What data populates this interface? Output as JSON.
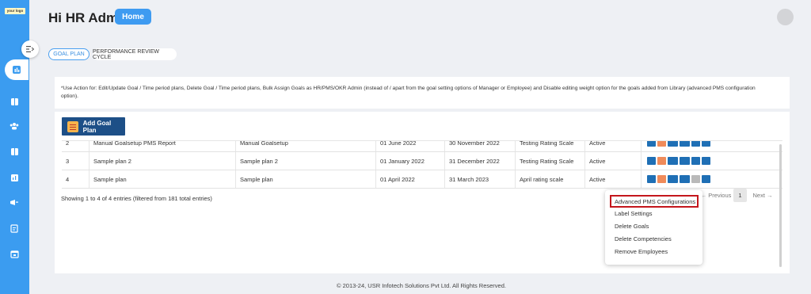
{
  "sidebar": {
    "logo_text": "your logo",
    "accent": "#3b9cf0"
  },
  "header": {
    "title": "Hi HR Admin",
    "home_label": "Home"
  },
  "tabs": [
    {
      "label": "GOAL PLAN",
      "active": true
    },
    {
      "label": "PERFORMANCE REVIEW CYCLE",
      "active": false
    }
  ],
  "info_note": "*Use Action for: Edit/Update Goal / Time period plans, Delete Goal / Time period plans, Bulk Assign Goals as HR/PMS/OKR Admin (instead of / apart from the goal setting options of Manager or Employee) and Disable editing weight option for the goals added from Library (advanced PMS configuration option).",
  "add_button_label": "Add Goal Plan",
  "table": {
    "rows": [
      {
        "no": "2",
        "plan": "Manual Goalsetup PMS Report",
        "description": "Manual Goalsetup",
        "start": "01 June 2022",
        "end": "30 November 2022",
        "scale": "Testing Rating Scale",
        "status": "Active",
        "gear_disabled": false
      },
      {
        "no": "3",
        "plan": "Sample plan 2",
        "description": "Sample plan 2",
        "start": "01 January 2022",
        "end": "31 December 2022",
        "scale": "Testing Rating Scale",
        "status": "Active",
        "gear_disabled": false
      },
      {
        "no": "4",
        "plan": "Sample plan",
        "description": "Sample plan",
        "start": "01 April 2022",
        "end": "31 March 2023",
        "scale": "April rating scale",
        "status": "Active",
        "gear_disabled": true
      }
    ]
  },
  "entries_info": "Showing 1 to 4 of 4 entries (filtered from 181 total entries)",
  "pagination": {
    "previous": "← Previous",
    "page": "1",
    "next": "Next →"
  },
  "dropdown": {
    "items": [
      "Advanced PMS Configurations",
      "Label Settings",
      "Delete Goals",
      "Delete Competencies",
      "Remove Employees"
    ]
  },
  "footer": "© 2013-24, USR Infotech Solutions Pvt Ltd. All Rights Reserved."
}
